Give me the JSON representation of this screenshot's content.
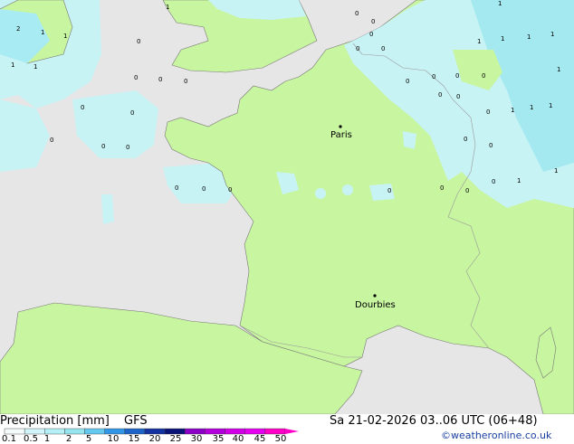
{
  "map": {
    "cities": [
      {
        "name": "Paris"
      },
      {
        "name": "Dourbies"
      }
    ],
    "colors": {
      "sea": "#e6e6e6",
      "land_dry": "#c8f5a0",
      "precip_light": "#b4f0f5",
      "precip_medium": "#96e6f0",
      "border": "#aaaaaa",
      "coast": "#777777"
    },
    "station_values": [
      "2",
      "1",
      "1",
      "1",
      "1",
      "1",
      "0",
      "0",
      "0",
      "0",
      "0",
      "0",
      "0",
      "0",
      "0",
      "0",
      "0",
      "0",
      "0",
      "0",
      "0",
      "0",
      "0",
      "1",
      "0",
      "1",
      "1",
      "1",
      "1",
      "1",
      "0",
      "0",
      "0",
      "0",
      "0",
      "0",
      "0",
      "1",
      "1",
      "1",
      "0",
      "0",
      "0",
      "0",
      "0",
      "1",
      "1"
    ]
  },
  "footer": {
    "title": "Precipitation [mm]",
    "model": "GFS",
    "datetime": "Sa 21-02-2026 03..06 UTC (06+48)",
    "credit": "©weatheronline.co.uk",
    "scale_ticks": [
      "0.1",
      "0.5",
      "1",
      "2",
      "5",
      "10",
      "15",
      "20",
      "25",
      "30",
      "35",
      "40",
      "45",
      "50"
    ],
    "scale_colors": [
      "#f5fafa",
      "#d2f5fa",
      "#b4f0f5",
      "#96e6f0",
      "#64c8f0",
      "#3296e6",
      "#1e64c8",
      "#1432a0",
      "#0a1478",
      "#8c00c8",
      "#b400dc",
      "#d200e6",
      "#e600f0",
      "#ff00c8"
    ]
  }
}
